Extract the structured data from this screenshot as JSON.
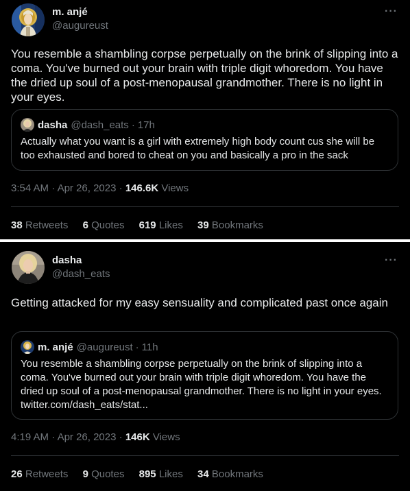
{
  "tweet1": {
    "display_name": "m. anjé",
    "handle": "@augureust",
    "more_label": "···",
    "text": "You resemble a shambling corpse perpetually on the brink of slipping into a coma. You've burned out your brain with triple digit whoredom. You have the dried up soul of a post-menopausal grandmother. There is no light in your eyes.",
    "quote": {
      "name": "dasha",
      "handle": "@dash_eats",
      "separator": "·",
      "time": "17h",
      "text": "Actually what you want is a girl with extremely high body count cus she will be too exhausted and bored to cheat on you and basically a pro in the sack"
    },
    "time": "3:54 AM",
    "date": "Apr 26, 2023",
    "dot": "·",
    "views_count": "146.6K",
    "views_label": "Views",
    "retweets_count": "38",
    "retweets_label": "Retweets",
    "quotes_count": "6",
    "quotes_label": "Quotes",
    "likes_count": "619",
    "likes_label": "Likes",
    "bookmarks_count": "39",
    "bookmarks_label": "Bookmarks"
  },
  "tweet2": {
    "display_name": "dasha",
    "handle": "@dash_eats",
    "more_label": "···",
    "text": "Getting attacked for my easy sensuality and complicated past once again",
    "quote": {
      "name": "m. anjé",
      "handle": "@augureust",
      "separator": "·",
      "time": "11h",
      "text": "You resemble a shambling corpse perpetually on the brink of slipping into a coma. You've burned out your brain with triple digit whoredom. You have the dried up soul of a post-menopausal grandmother. There is no light in your eyes. twitter.com/dash_eats/stat..."
    },
    "time": "4:19 AM",
    "date": "Apr 26, 2023",
    "dot": "·",
    "views_count": "146K",
    "views_label": "Views",
    "retweets_count": "26",
    "retweets_label": "Retweets",
    "quotes_count": "9",
    "quotes_label": "Quotes",
    "likes_count": "895",
    "likes_label": "Likes",
    "bookmarks_count": "34",
    "bookmarks_label": "Bookmarks"
  },
  "colors": {
    "background": "#000000",
    "text": "#e7e9ea",
    "muted": "#71767b",
    "border": "#2f3336"
  }
}
